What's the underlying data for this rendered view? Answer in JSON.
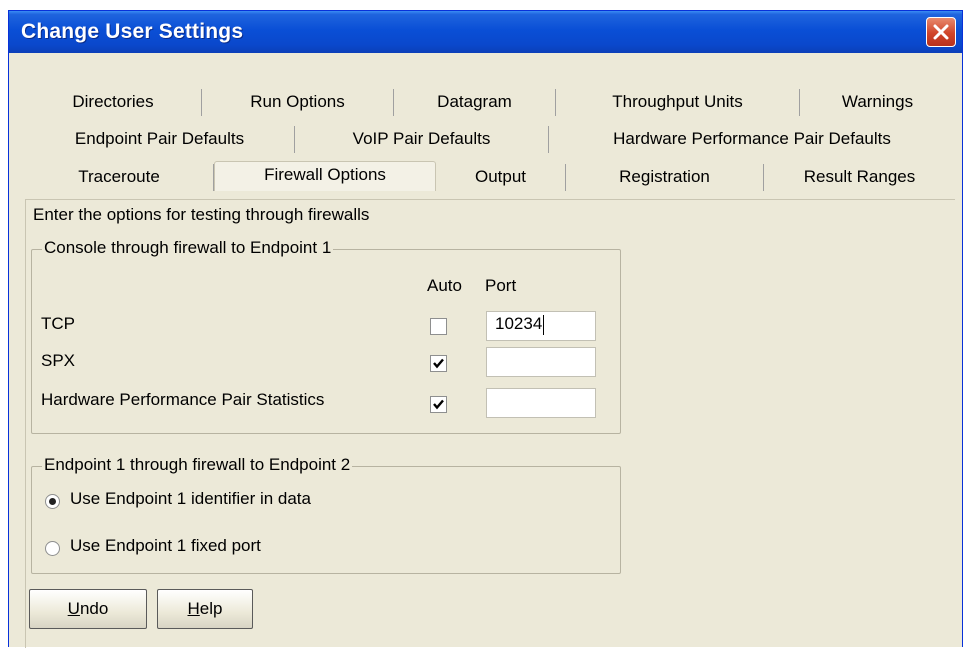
{
  "window": {
    "title": "Change User Settings"
  },
  "tabs": {
    "row1": [
      "Directories",
      "Run Options",
      "Datagram",
      "Throughput Units",
      "Warnings"
    ],
    "row2": [
      "Endpoint Pair Defaults",
      "VoIP Pair Defaults",
      "Hardware Performance Pair Defaults"
    ],
    "row3": [
      "Traceroute",
      "Firewall Options",
      "Output",
      "Registration",
      "Result Ranges"
    ],
    "active": "Firewall Options"
  },
  "panel": {
    "prompt": "Enter the options for testing through firewalls",
    "console_group": {
      "title": "Console through firewall to Endpoint 1",
      "col_auto": "Auto",
      "col_port": "Port",
      "rows": [
        {
          "label": "TCP",
          "auto": false,
          "port": "10234"
        },
        {
          "label": "SPX",
          "auto": true,
          "port": ""
        },
        {
          "label": "Hardware Performance Pair Statistics",
          "auto": true,
          "port": ""
        }
      ]
    },
    "endpoint_group": {
      "title": "Endpoint 1 through firewall to Endpoint 2",
      "options": [
        {
          "label": "Use Endpoint 1 identifier in data",
          "selected": true
        },
        {
          "label": "Use Endpoint 1 fixed port",
          "selected": false
        }
      ]
    }
  },
  "buttons": {
    "undo_mnemonic": "U",
    "undo_rest": "ndo",
    "help_mnemonic": "H",
    "help_rest": "elp"
  },
  "colors": {
    "titlebar": "#0a4fd6",
    "dialog_bg": "#ece9d8",
    "close_button": "#d0452a"
  },
  "icons": {
    "close": "close-x-icon",
    "checkbox_check": "checkmark-icon"
  }
}
